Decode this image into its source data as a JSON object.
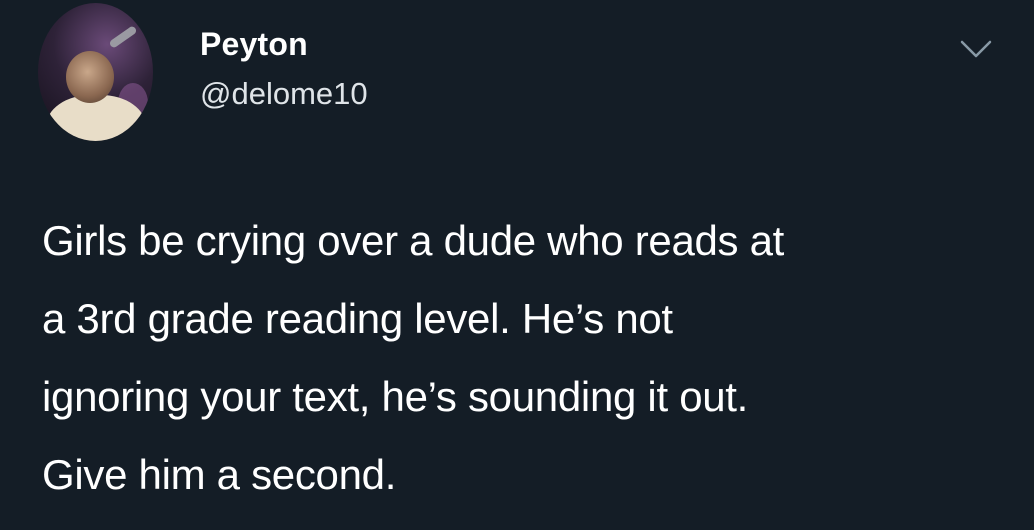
{
  "tweet": {
    "author": {
      "display_name": "Peyton",
      "handle": "@delome10",
      "avatar_icon": "profile-photo-avatar"
    },
    "menu_icon": "chevron-down-icon",
    "text_lines": [
      "Girls be crying over a dude who reads at",
      "a 3rd grade reading level. He’s not",
      "ignoring your text, he’s sounding it out.",
      "Give him a second."
    ]
  },
  "colors": {
    "background": "#141d26",
    "text": "#ffffff",
    "secondary_text": "#dfe4e8",
    "icon": "#8899a6"
  }
}
